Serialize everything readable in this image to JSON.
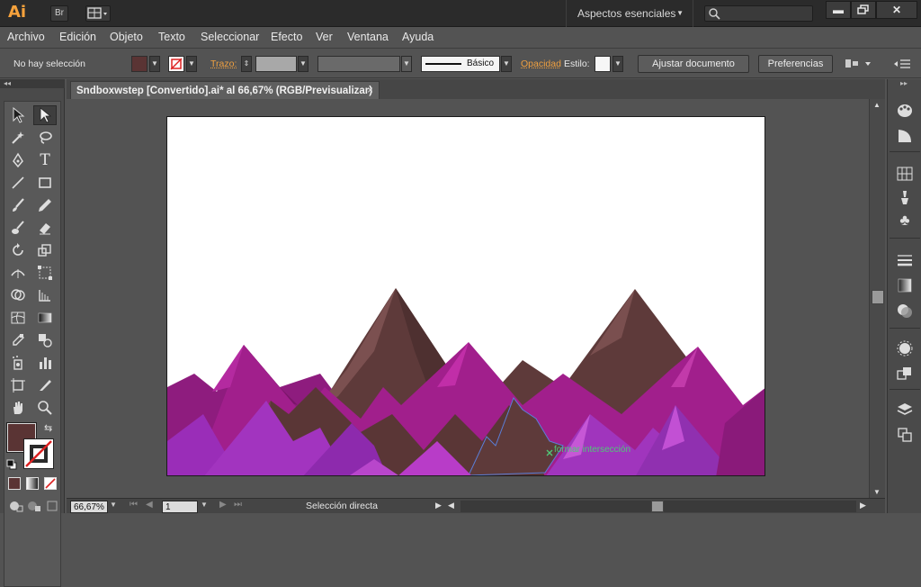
{
  "app": {
    "logo": "Ai",
    "bridge_label": "Br",
    "workspace": "Aspectos esenciales",
    "search_placeholder": ""
  },
  "menu": [
    "Archivo",
    "Edición",
    "Objeto",
    "Texto",
    "Seleccionar",
    "Efecto",
    "Ver",
    "Ventana",
    "Ayuda"
  ],
  "control": {
    "selection_status": "No hay selección",
    "stroke_label": "Trazo:",
    "stroke_style": "Básico",
    "opacity_label": "Opacidad",
    "style_label": "Estilo:",
    "fit_document_button": "Ajustar documento",
    "preferences_button": "Preferencias"
  },
  "document": {
    "tab_title": "Sndboxwstep [Convertido].ai* al 66,67% (RGB/Previsualizar)",
    "tab_close": "×",
    "tooltip": "formar intersección"
  },
  "status": {
    "zoom": "66,67%",
    "page": "1",
    "tool": "Selección directa"
  },
  "colors": {
    "fill": "#5a3434",
    "accent": "#f6a23c",
    "mountain_brown": "#5e3a3a",
    "mountain_magenta": "#9b1d86",
    "mountain_violet": "#b13cc4",
    "hint_green": "#50c878"
  }
}
